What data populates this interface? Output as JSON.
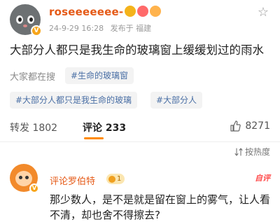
{
  "post": {
    "username": "roseeeeeee-",
    "timestamp": "24-9-29 16:28",
    "source": "发布于 福建",
    "verified_badge": "V",
    "content": "大部分人都只是我生命的玻璃窗上缓缓划过的雨水"
  },
  "topics": {
    "label": "大家都在搜",
    "chips": [
      "#生命的玻璃窗",
      "#大部分人都只是我生命的玻璃",
      "#大部分人"
    ]
  },
  "actions": {
    "repost": "转发 1802",
    "comments": "评论 233",
    "likes": "8271",
    "active_color": "#ff8a00"
  },
  "sort": {
    "label": "按热度"
  },
  "comment": {
    "author": "评论罗伯特",
    "level": "1",
    "author_tag": "自评",
    "text": "那少数人，是不是就是留在窗上的雾气，让人看不清，却也舍不得擦去?"
  },
  "colors": {
    "username": "#e55a17",
    "topic_link": "#4a6fa5",
    "accent": "#ff8a00"
  }
}
